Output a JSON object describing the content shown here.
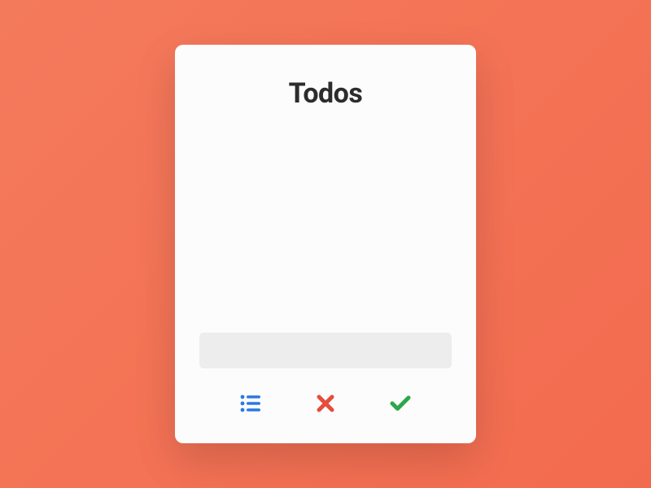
{
  "card": {
    "title": "Todos"
  },
  "input": {
    "value": "",
    "placeholder": ""
  },
  "colors": {
    "list_icon": "#2b79e0",
    "x_icon": "#e74c3c",
    "check_icon": "#2ba84a"
  }
}
